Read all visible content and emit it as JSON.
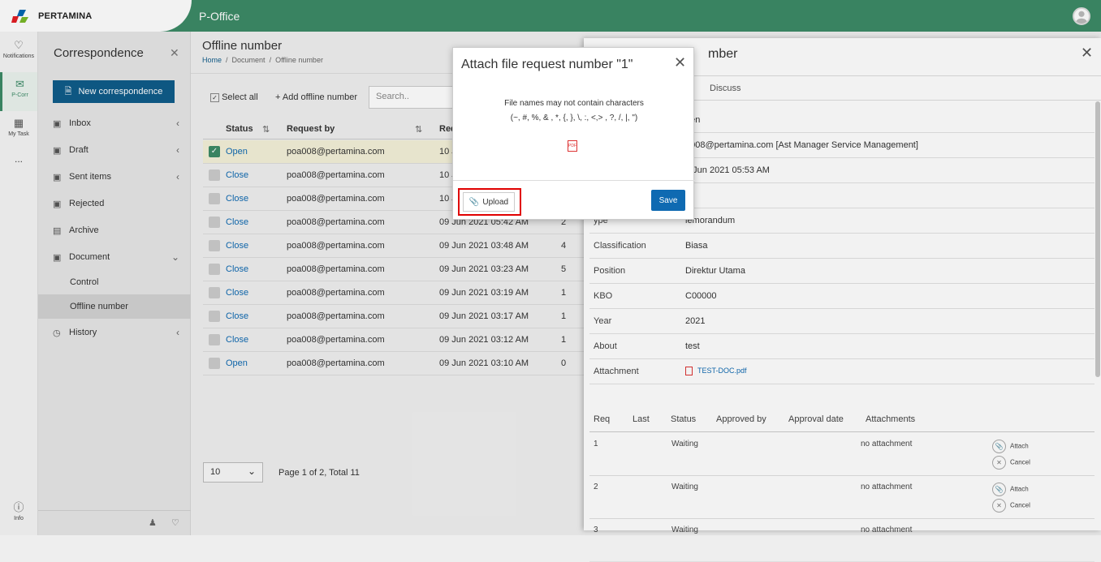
{
  "brand": {
    "logo_text": "PERTAMINA",
    "app_title": "P-Office"
  },
  "rail": {
    "notifications": "Notifications",
    "pcorr": "P-Corr",
    "mytask": "My Task",
    "more": "...",
    "info": "Info"
  },
  "sidebar": {
    "title": "Correspondence",
    "new_button": "New correspondence",
    "items": [
      {
        "label": "Inbox"
      },
      {
        "label": "Draft"
      },
      {
        "label": "Sent items"
      },
      {
        "label": "Rejected"
      },
      {
        "label": "Archive"
      },
      {
        "label": "Document"
      },
      {
        "label": "Control"
      },
      {
        "label": "Offline number"
      },
      {
        "label": "History"
      }
    ]
  },
  "page": {
    "title": "Offline number",
    "crumbs": [
      "Home",
      "Document",
      "Offline number"
    ],
    "select_all": "Select all",
    "add_offline": "Add offline number",
    "search_placeholder": "Search..",
    "columns": [
      "Status",
      "Request by",
      "Req"
    ],
    "rows": [
      {
        "status": "Open",
        "by": "poa008@pertamina.com",
        "date": "10 J",
        "n": ""
      },
      {
        "status": "Close",
        "by": "poa008@pertamina.com",
        "date": "10 J",
        "n": ""
      },
      {
        "status": "Close",
        "by": "poa008@pertamina.com",
        "date": "10 J",
        "n": ""
      },
      {
        "status": "Close",
        "by": "poa008@pertamina.com",
        "date": "09 Jun 2021 05:42 AM",
        "n": "2"
      },
      {
        "status": "Close",
        "by": "poa008@pertamina.com",
        "date": "09 Jun 2021 03:48 AM",
        "n": "4"
      },
      {
        "status": "Close",
        "by": "poa008@pertamina.com",
        "date": "09 Jun 2021 03:23 AM",
        "n": "5"
      },
      {
        "status": "Close",
        "by": "poa008@pertamina.com",
        "date": "09 Jun 2021 03:19 AM",
        "n": "1"
      },
      {
        "status": "Close",
        "by": "poa008@pertamina.com",
        "date": "09 Jun 2021 03:17 AM",
        "n": "1"
      },
      {
        "status": "Close",
        "by": "poa008@pertamina.com",
        "date": "09 Jun 2021 03:12 AM",
        "n": "1"
      },
      {
        "status": "Open",
        "by": "poa008@pertamina.com",
        "date": "09 Jun 2021 03:10 AM",
        "n": "0"
      }
    ],
    "page_size": "10",
    "pager_text": "Page 1 of 2, Total 11"
  },
  "panel": {
    "title": "mber",
    "tab": "Discuss",
    "fields": [
      {
        "k": "",
        "v": "pen"
      },
      {
        "k": "",
        "v": "a008@pertamina.com [Ast Manager Service Management]"
      },
      {
        "k": "",
        "v": "9 Jun 2021 05:53 AM"
      },
      {
        "k": "",
        "v": ""
      },
      {
        "k": "ype",
        "v": "lemorandum"
      },
      {
        "k": "Classification",
        "v": "Biasa"
      },
      {
        "k": "Position",
        "v": "Direktur Utama"
      },
      {
        "k": "KBO",
        "v": "C00000"
      },
      {
        "k": "Year",
        "v": "2021"
      },
      {
        "k": "About",
        "v": "test"
      },
      {
        "k": "Attachment",
        "v": "TEST-DOC.pdf"
      }
    ],
    "req_columns": [
      "Req",
      "Last",
      "Status",
      "Approved by",
      "Approval date",
      "Attachments"
    ],
    "req_rows": [
      {
        "req": "1",
        "status": "Waiting",
        "attach": "no attachment",
        "a1": "Attach",
        "a2": "Cancel"
      },
      {
        "req": "2",
        "status": "Waiting",
        "attach": "no attachment",
        "a1": "Attach",
        "a2": "Cancel"
      },
      {
        "req": "3",
        "status": "Waiting",
        "attach": "no attachment",
        "a1": "",
        "a2": ""
      }
    ]
  },
  "modal": {
    "title": "Attach file request number \"1\"",
    "note_line1": "File names may not contain characters",
    "note_line2": "(~, #, %, & , *, {, }, \\, :, <,> , ?, /, |, \")",
    "pdf_label": "PDF",
    "upload": "Upload",
    "save": "Save"
  },
  "colors": {
    "brand_green": "#3d8b67",
    "primary_blue": "#0f5c8a",
    "highlight_red": "#e00000"
  }
}
